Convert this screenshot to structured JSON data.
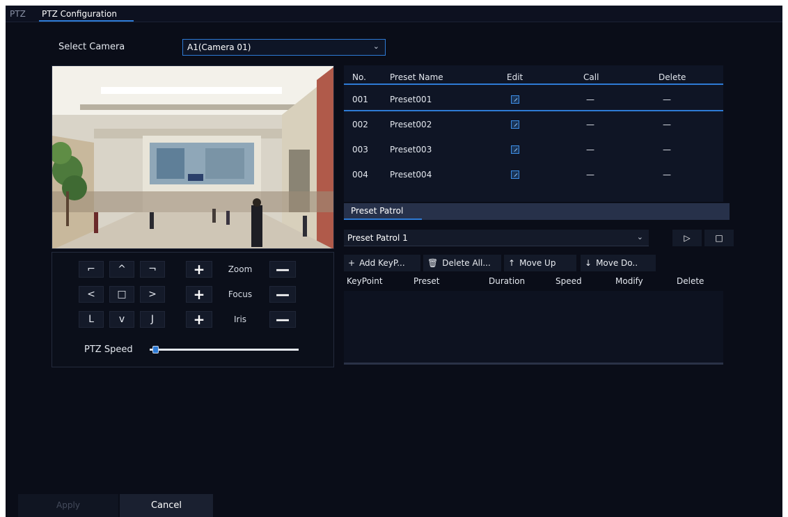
{
  "tabs": {
    "ptz": "PTZ",
    "ptz_config": "PTZ Configuration"
  },
  "camera": {
    "label": "Select Camera",
    "value": "A1(Camera 01)"
  },
  "controls": {
    "directions": {
      "up_left": "⌐",
      "up": "^",
      "up_right": "¬",
      "left": "<",
      "center": "□",
      "right": ">",
      "down_left": "L",
      "down": "v",
      "down_right": "J"
    },
    "plus": "+",
    "minus": "—",
    "zoom": "Zoom",
    "focus": "Focus",
    "iris": "Iris",
    "speed_label": "PTZ Speed",
    "speed_value": 0.02
  },
  "preset_table": {
    "headers": {
      "no": "No.",
      "name": "Preset Name",
      "edit": "Edit",
      "call": "Call",
      "delete": "Delete"
    },
    "rows": [
      {
        "no": "001",
        "name": "Preset001",
        "call": "—",
        "delete": "—"
      },
      {
        "no": "002",
        "name": "Preset002",
        "call": "—",
        "delete": "—"
      },
      {
        "no": "003",
        "name": "Preset003",
        "call": "—",
        "delete": "—"
      },
      {
        "no": "004",
        "name": "Preset004",
        "call": "—",
        "delete": "—"
      }
    ]
  },
  "patrol": {
    "section_title": "Preset Patrol",
    "selected": "Preset Patrol 1",
    "play_icon": "▷",
    "stop_icon": "□",
    "toolbar": {
      "add": "Add KeyP...",
      "delete_all": "Delete All...",
      "move_up": "Move Up",
      "move_down": "Move Do.."
    },
    "columns": {
      "keypoint": "KeyPoint",
      "preset": "Preset",
      "duration": "Duration",
      "speed": "Speed",
      "modify": "Modify",
      "delete": "Delete"
    }
  },
  "buttons": {
    "apply": "Apply",
    "cancel": "Cancel"
  },
  "colors": {
    "accent": "#2e7bd6",
    "background": "#0a0d18"
  }
}
